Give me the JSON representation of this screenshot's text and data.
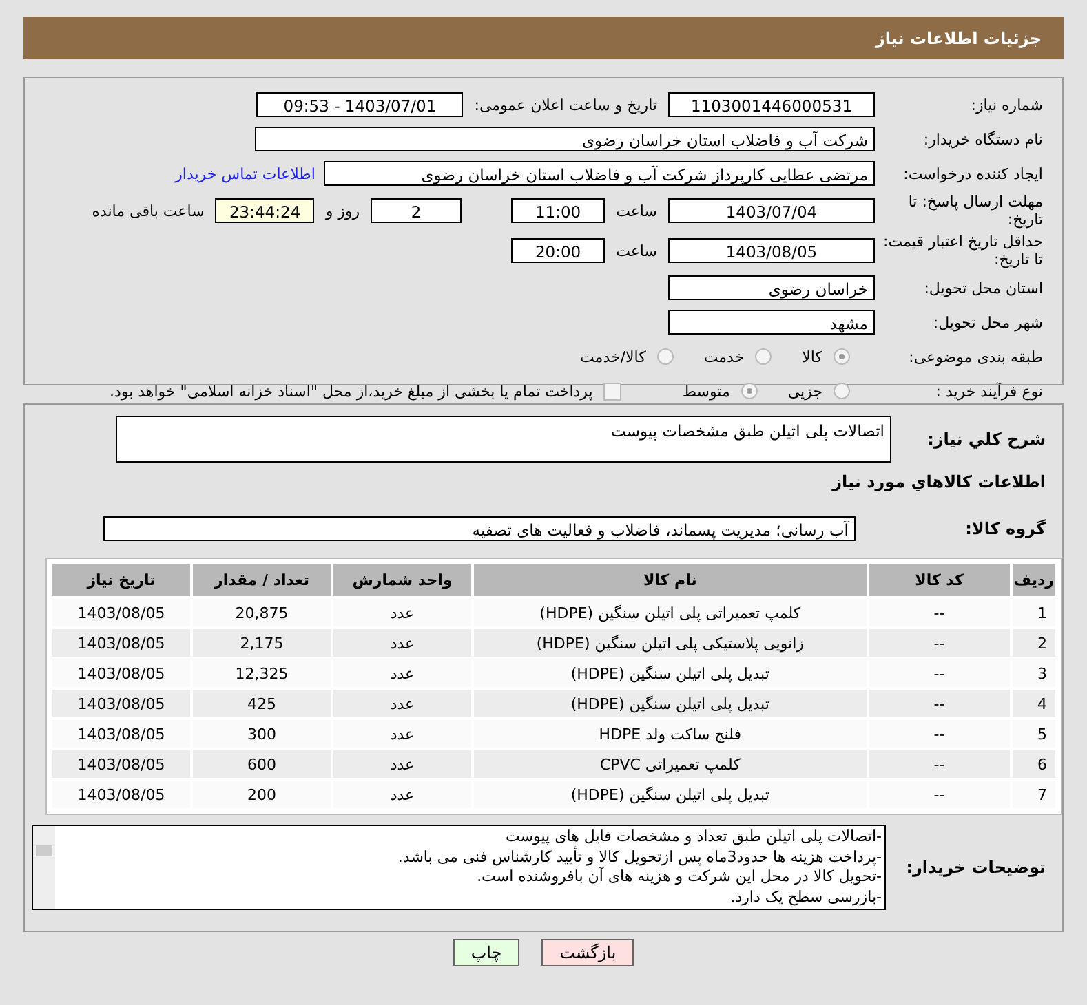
{
  "header": {
    "title": "جزئیات اطلاعات نیاز"
  },
  "need_number": {
    "label": "شماره نیاز:",
    "value": "1103001446000531"
  },
  "announce_datetime": {
    "label": "تاریخ و ساعت اعلان عمومی:",
    "value": "1403/07/01 - 09:53"
  },
  "buyer_org": {
    "label": "نام دستگاه خریدار:",
    "value": "شرکت آب و فاضلاب استان خراسان رضوی"
  },
  "requester": {
    "label": "ایجاد کننده درخواست:",
    "value": "مرتضی عطایی کارپرداز شرکت آب و فاضلاب استان خراسان رضوی",
    "link": "اطلاعات تماس خریدار"
  },
  "reply_deadline": {
    "label": "مهلت ارسال پاسخ: تا تاریخ:",
    "date": "1403/07/04",
    "time_label": "ساعت",
    "time": "11:00",
    "days": "2",
    "days_label": "روز و",
    "remaining": "23:44:24",
    "remaining_label": "ساعت باقی مانده"
  },
  "price_validity": {
    "label": "حداقل تاریخ اعتبار قیمت: تا تاریخ:",
    "date": "1403/08/05",
    "time_label": "ساعت",
    "time": "20:00"
  },
  "delivery_province": {
    "label": "استان محل تحویل:",
    "value": "خراسان رضوی"
  },
  "delivery_city": {
    "label": "شهر محل تحویل:",
    "value": "مشهد"
  },
  "category": {
    "label": "طبقه بندی موضوعی:",
    "options": [
      {
        "label": "کالا",
        "selected": true
      },
      {
        "label": "خدمت",
        "selected": false
      },
      {
        "label": "کالا/خدمت",
        "selected": false
      }
    ]
  },
  "purchase_process": {
    "label": "نوع فرآیند خرید :",
    "options": [
      {
        "label": "جزیی",
        "selected": false
      },
      {
        "label": "متوسط",
        "selected": true
      }
    ],
    "treasury": {
      "label": "پرداخت تمام یا بخشی از مبلغ خرید،از محل \"اسناد خزانه اسلامی\" خواهد بود.",
      "checked": false
    }
  },
  "description": {
    "label": "شرح کلي نياز:",
    "value": "اتصالات پلی اتیلن طبق مشخصات پیوست"
  },
  "items_heading": "اطلاعات کالاهاي مورد نياز",
  "goods_group": {
    "label": "گروه کالا:",
    "value": "آب رسانی؛ مدیریت پسماند، فاضلاب و فعالیت های تصفیه"
  },
  "table": {
    "columns": [
      "ردیف",
      "کد کالا",
      "نام کالا",
      "واحد شمارش",
      "تعداد / مقدار",
      "تاریخ نیاز"
    ],
    "rows": [
      [
        "1",
        "--",
        "کلمپ تعمیراتی پلی اتیلن سنگین (HDPE)",
        "عدد",
        "20,875",
        "1403/08/05"
      ],
      [
        "2",
        "--",
        "زانویی پلاستیکی پلی اتیلن سنگین (HDPE)",
        "عدد",
        "2,175",
        "1403/08/05"
      ],
      [
        "3",
        "--",
        "تبدیل پلی اتیلن سنگین (HDPE)",
        "عدد",
        "12,325",
        "1403/08/05"
      ],
      [
        "4",
        "--",
        "تبدیل پلی اتیلن سنگین (HDPE)",
        "عدد",
        "425",
        "1403/08/05"
      ],
      [
        "5",
        "--",
        "فلنج ساکت ولد HDPE",
        "عدد",
        "300",
        "1403/08/05"
      ],
      [
        "6",
        "--",
        "کلمپ تعمیراتی CPVC",
        "عدد",
        "600",
        "1403/08/05"
      ],
      [
        "7",
        "--",
        "تبدیل پلی اتیلن سنگین (HDPE)",
        "عدد",
        "200",
        "1403/08/05"
      ]
    ]
  },
  "buyer_notes": {
    "label": "توضیحات خریدار:",
    "lines": [
      "-اتصالات پلی اتیلن طبق تعداد و مشخصات فایل های پیوست",
      "-پرداخت هزینه ها حدود3ماه پس ازتحویل کالا و تأیید کارشناس فنی می باشد.",
      "-تحویل کالا در محل این شرکت و هزینه های آن بافروشنده است.",
      "-بازرسی سطح یک دارد."
    ]
  },
  "buttons": [
    {
      "label": "بازگشت",
      "kind": "back"
    },
    {
      "label": "چاپ",
      "kind": "print"
    }
  ]
}
